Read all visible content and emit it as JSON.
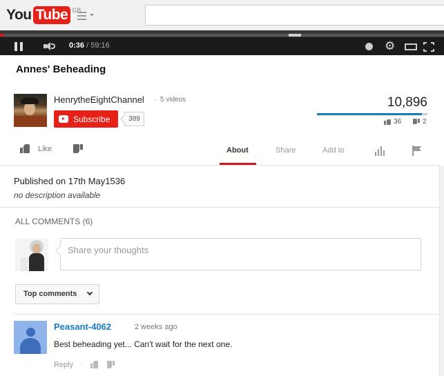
{
  "masthead": {
    "logo_you": "You",
    "logo_tube": "Tube",
    "region": "GB",
    "search_placeholder": ""
  },
  "player": {
    "current_time": "0:36",
    "duration": "/ 59:16",
    "played_fraction": 0.01,
    "icons": [
      "pause-icon",
      "volume-icon",
      "watch-later-icon",
      "settings-icon",
      "theater-mode-icon",
      "fullscreen-icon"
    ]
  },
  "video": {
    "title": "Annes' Beheading",
    "views": "10,896",
    "likes": "36",
    "dislikes": "2",
    "like_ratio": 0.947
  },
  "channel": {
    "name": "HenrytheEightChannel",
    "separator": "·",
    "video_count": "5 videos",
    "subscribe_label": "Subscribe",
    "subscriber_count": "389"
  },
  "actions": {
    "like_label": "Like",
    "tabs": [
      {
        "label": "About",
        "active": true
      },
      {
        "label": "Share",
        "active": false
      },
      {
        "label": "Add to",
        "active": false
      }
    ]
  },
  "description": {
    "published": "Published on 17th May1536",
    "text": "no description available"
  },
  "comments": {
    "header": "ALL COMMENTS (6)",
    "input_placeholder": "Share your thoughts",
    "sort_label": "Top comments",
    "items": [
      {
        "author": "Peasant-4062",
        "time": "2 weeks ago",
        "text": "Best beheading yet... Can't wait for the next one.",
        "reply_label": "Reply",
        "separator": "·"
      }
    ]
  },
  "colors": {
    "brand_red": "#e62117",
    "link_blue": "#167ac6",
    "active_tab_red": "#cc181e"
  }
}
